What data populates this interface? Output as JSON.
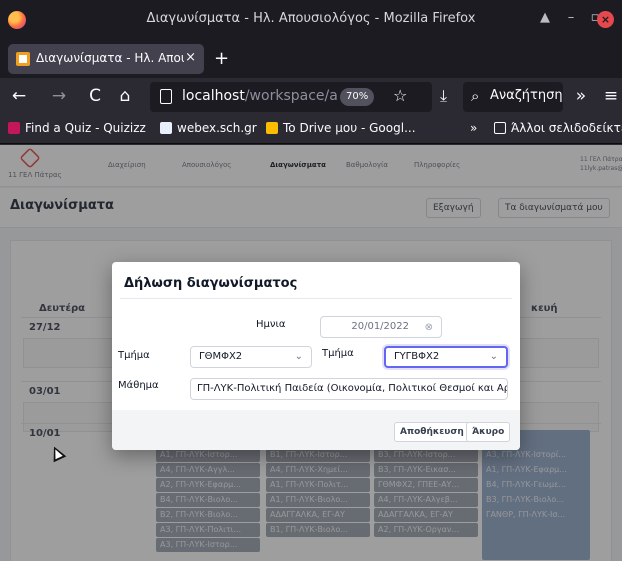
{
  "window": {
    "title": "Διαγωνίσματα - Ηλ. Απουσιολόγος - Mozilla Firefox"
  },
  "tab": {
    "label": "Διαγωνίσματα - Ηλ. Απουσι",
    "close": "×",
    "new_tab": "+"
  },
  "nav": {
    "back": "←",
    "forward": "→",
    "reload": "C",
    "home": "⌂",
    "url_host": "localhost",
    "url_path": "/workspace/a",
    "zoom": "70%",
    "star": "☆",
    "download": "⤓",
    "search_placeholder": "Αναζήτηση",
    "overflow": "»",
    "menu": "≡"
  },
  "bookmarks": {
    "items": [
      {
        "label": "Find a Quiz - Quizizz",
        "color": "#c2185b"
      },
      {
        "label": "webex.sch.gr",
        "color": "#e8f0fe"
      },
      {
        "label": "To Drive μου - Googl...",
        "color": "#fbbc04"
      }
    ],
    "overflow": "»",
    "other": "Άλλοι σελιδοδείκτες"
  },
  "app": {
    "name": "11 ΓΕΛ Πάτρας",
    "menu": [
      "Διαχείριση",
      "Απουσιολόγος",
      "Διαγωνίσματα",
      "Βαθμολογία",
      "Πληροφορίες"
    ],
    "user_name": "11 ΓΕΛ Πάτρας",
    "user_email": "11lyk.patras@gmail.com",
    "page_title": "Διαγωνίσματα",
    "export_button": "Εξαγωγή",
    "my_tests_button": "Τα διαγωνίσματά μου"
  },
  "calendar": {
    "day_monday": "Δευτέρα",
    "day_friday_partial": "κευή",
    "dates": [
      "27/12",
      "03/01",
      "10/01"
    ],
    "chips_col1": [
      "Α1, ΓΠ-ΛΥΚ-Ιστορ...",
      "Α4, ΓΠ-ΛΥΚ-Αγγλ...",
      "Α2, ΓΠ-ΛΥΚ-Εφαρμ...",
      "Β4, ΓΠ-ΛΥΚ-Βιολο...",
      "Β2, ΓΠ-ΛΥΚ-Βιολο...",
      "Α3, ΓΠ-ΛΥΚ-Πολιτι...",
      "Α3, ΓΠ-ΛΥΚ-Ιστορ..."
    ],
    "chips_col2": [
      "Β1, ΓΠ-ΛΥΚ-Ιστορ...",
      "Α4, ΓΠ-ΛΥΚ-Χημεί...",
      "Α1, ΓΠ-ΛΥΚ-Πολιτ...",
      "Α1, ΓΠ-ΛΥΚ-Βιολο...",
      "ΑΔΑΓΓΑΛΚΑ, ΕΓ-ΑΥ",
      "Β1, ΓΠ-ΛΥΚ-Βιολο..."
    ],
    "chips_col3": [
      "Β3, ΓΠ-ΛΥΚ-Ιστορ...",
      "Β3, ΓΠ-ΛΥΚ-Εικασ...",
      "ΓΘΜΦΧ2, ΓΠΕΕ-ΑΥ...",
      "Α4, ΓΠ-ΛΥΚ-Αλγεβ...",
      "ΑΔΑΓΓΑΛΚΑ, ΕΓ-ΑΥ",
      "Α2, ΓΠ-ΛΥΚ-Οργαν..."
    ],
    "chips_col4": [
      "Α3, ΓΠ-ΛΥΚ-Ιστορί...",
      "Α1, ΓΠ-ΛΥΚ-Εφαρμ...",
      "Β4, ΓΠ-ΛΥΚ-Γεωμε...",
      "Β3, ΓΠ-ΛΥΚ-Βιολο...",
      "ΓΑΝΘΡ, ΓΠ-ΛΥΚ-Ισ..."
    ]
  },
  "modal": {
    "title": "Δήλωση διαγωνίσματος",
    "date_label": "Ημνια",
    "date_value": "20/01/2022",
    "date_clear": "⊗",
    "class1_label": "Τμήμα",
    "class1_value": "ΓΘΜΦΧ2",
    "class2_label": "Τμήμα",
    "class2_value": "ΓΥΓΒΦΧ2",
    "subject_label": "Μάθημα",
    "subject_value": "ΓΠ-ΛΥΚ-Πολιτική Παιδεία (Οικονομία, Πολιτικοί Θεσμοί και Αρχές",
    "save_button": "Αποθήκευση",
    "cancel_button": "Άκυρο"
  }
}
